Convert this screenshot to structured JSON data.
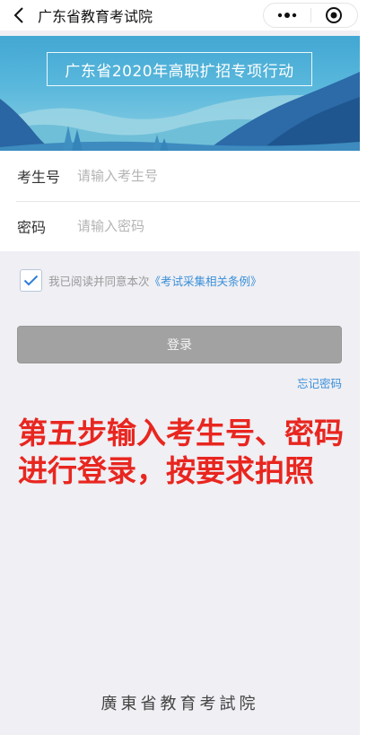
{
  "navbar": {
    "title": "广东省教育考试院",
    "back_icon": "chevron-left-icon",
    "more_icon": "more-dots-icon",
    "close_icon": "target-close-icon"
  },
  "banner": {
    "title": "广东省2020年高职扩招专项行动"
  },
  "form": {
    "student_id_label": "考生号",
    "student_id_placeholder": "请输入考生号",
    "password_label": "密码",
    "password_placeholder": "请输入密码"
  },
  "agreement": {
    "checked": true,
    "text": "我已阅读并同意本次",
    "link": "《考试采集相关条例》"
  },
  "login_button": "登录",
  "forgot_password": "忘记密码",
  "instruction": {
    "line1": "第五步输入考生号、密码",
    "line2": "进行登录，按要求拍照"
  },
  "footer": "廣東省教育考試院",
  "colors": {
    "accent_blue": "#3a8fd8",
    "instruction_red": "#e8261f",
    "button_gray": "#a2a2a2"
  }
}
